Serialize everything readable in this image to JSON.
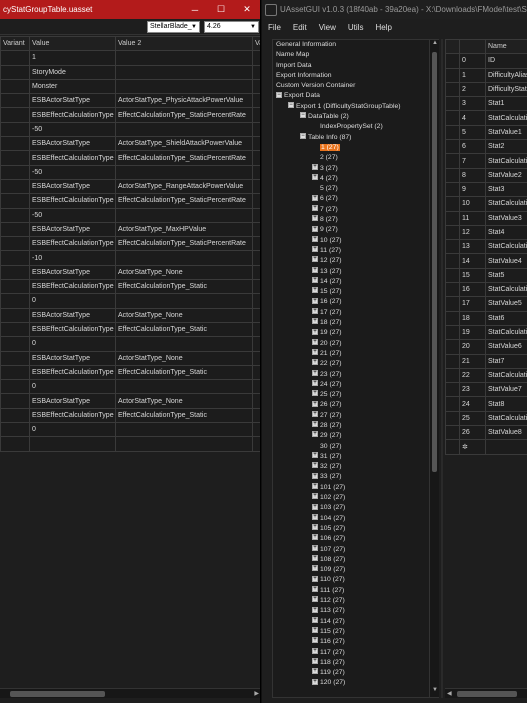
{
  "left_window": {
    "title": "cyStatGroupTable.uasset",
    "minimize": "─",
    "maximize": "☐",
    "close": "✕",
    "combo_game": "StellarBlade_",
    "combo_version": "4.26",
    "columns": [
      "Variant",
      "Value",
      "Value 2",
      "Va"
    ],
    "rows": [
      [
        "",
        "1",
        "",
        ""
      ],
      [
        "",
        "StoryMode",
        "",
        ""
      ],
      [
        "",
        "Monster",
        "",
        ""
      ],
      [
        "",
        "ESBActorStatType",
        "ActorStatType_PhysicAttackPowerValue",
        ""
      ],
      [
        "",
        "ESBEffectCalculationType",
        "EffectCalculationType_StaticPercentRate",
        ""
      ],
      [
        "",
        "-50",
        "",
        ""
      ],
      [
        "",
        "ESBActorStatType",
        "ActorStatType_ShieldAttackPowerValue",
        ""
      ],
      [
        "",
        "ESBEffectCalculationType",
        "EffectCalculationType_StaticPercentRate",
        ""
      ],
      [
        "",
        "-50",
        "",
        ""
      ],
      [
        "",
        "ESBActorStatType",
        "ActorStatType_RangeAttackPowerValue",
        ""
      ],
      [
        "",
        "ESBEffectCalculationType",
        "EffectCalculationType_StaticPercentRate",
        ""
      ],
      [
        "",
        "-50",
        "",
        ""
      ],
      [
        "",
        "ESBActorStatType",
        "ActorStatType_MaxHPValue",
        ""
      ],
      [
        "",
        "ESBEffectCalculationType",
        "EffectCalculationType_StaticPercentRate",
        ""
      ],
      [
        "",
        "-10",
        "",
        ""
      ],
      [
        "",
        "ESBActorStatType",
        "ActorStatType_None",
        ""
      ],
      [
        "",
        "ESBEffectCalculationType",
        "EffectCalculationType_Static",
        ""
      ],
      [
        "",
        "0",
        "",
        ""
      ],
      [
        "",
        "ESBActorStatType",
        "ActorStatType_None",
        ""
      ],
      [
        "",
        "ESBEffectCalculationType",
        "EffectCalculationType_Static",
        ""
      ],
      [
        "",
        "0",
        "",
        ""
      ],
      [
        "",
        "ESBActorStatType",
        "ActorStatType_None",
        ""
      ],
      [
        "",
        "ESBEffectCalculationType",
        "EffectCalculationType_Static",
        ""
      ],
      [
        "",
        "0",
        "",
        ""
      ],
      [
        "",
        "ESBActorStatType",
        "ActorStatType_None",
        ""
      ],
      [
        "",
        "ESBEffectCalculationType",
        "EffectCalculationType_Static",
        ""
      ],
      [
        "",
        "0",
        "",
        ""
      ],
      [
        "",
        "",
        "",
        ""
      ]
    ]
  },
  "right_window": {
    "title": "UAssetGUI v1.0.3 (18f40ab - 39a20ea) - X:\\Downloads\\FModel\\test\\SB\\C",
    "menu": [
      "File",
      "Edit",
      "View",
      "Utils",
      "Help"
    ],
    "tree": [
      {
        "label": "General Information",
        "level": 0,
        "expander": ""
      },
      {
        "label": "Name Map",
        "level": 0,
        "expander": ""
      },
      {
        "label": "Import Data",
        "level": 0,
        "expander": ""
      },
      {
        "label": "Export Information",
        "level": 0,
        "expander": ""
      },
      {
        "label": "Custom Version Container",
        "level": 0,
        "expander": ""
      },
      {
        "label": "Export Data",
        "level": 0,
        "expander": "−"
      },
      {
        "label": "Export 1 (DifficultyStatGroupTable)",
        "level": 1,
        "expander": "−"
      },
      {
        "label": "DataTable (2)",
        "level": 2,
        "expander": "−"
      },
      {
        "label": "IndexPropertySet (2)",
        "level": 3,
        "expander": ""
      },
      {
        "label": "Table Info (87)",
        "level": 2,
        "expander": "−"
      },
      {
        "label": "1 (27)",
        "level": 3,
        "expander": "",
        "selected": true
      },
      {
        "label": "2 (27)",
        "level": 3,
        "expander": ""
      },
      {
        "label": "3 (27)",
        "level": 3,
        "expander": "+"
      },
      {
        "label": "4 (27)",
        "level": 3,
        "expander": "+"
      },
      {
        "label": "5 (27)",
        "level": 3,
        "expander": ""
      },
      {
        "label": "6 (27)",
        "level": 3,
        "expander": "+"
      },
      {
        "label": "7 (27)",
        "level": 3,
        "expander": "+"
      },
      {
        "label": "8 (27)",
        "level": 3,
        "expander": "+"
      },
      {
        "label": "9 (27)",
        "level": 3,
        "expander": "+"
      },
      {
        "label": "10 (27)",
        "level": 3,
        "expander": "+"
      },
      {
        "label": "11 (27)",
        "level": 3,
        "expander": "+"
      },
      {
        "label": "12 (27)",
        "level": 3,
        "expander": "+"
      },
      {
        "label": "13 (27)",
        "level": 3,
        "expander": "+"
      },
      {
        "label": "14 (27)",
        "level": 3,
        "expander": "+"
      },
      {
        "label": "15 (27)",
        "level": 3,
        "expander": "+"
      },
      {
        "label": "16 (27)",
        "level": 3,
        "expander": "+"
      },
      {
        "label": "17 (27)",
        "level": 3,
        "expander": "+"
      },
      {
        "label": "18 (27)",
        "level": 3,
        "expander": "+"
      },
      {
        "label": "19 (27)",
        "level": 3,
        "expander": "+"
      },
      {
        "label": "20 (27)",
        "level": 3,
        "expander": "+"
      },
      {
        "label": "21 (27)",
        "level": 3,
        "expander": "+"
      },
      {
        "label": "22 (27)",
        "level": 3,
        "expander": "+"
      },
      {
        "label": "23 (27)",
        "level": 3,
        "expander": "+"
      },
      {
        "label": "24 (27)",
        "level": 3,
        "expander": "+"
      },
      {
        "label": "25 (27)",
        "level": 3,
        "expander": "+"
      },
      {
        "label": "26 (27)",
        "level": 3,
        "expander": "+"
      },
      {
        "label": "27 (27)",
        "level": 3,
        "expander": "+"
      },
      {
        "label": "28 (27)",
        "level": 3,
        "expander": "+"
      },
      {
        "label": "29 (27)",
        "level": 3,
        "expander": "+"
      },
      {
        "label": "30 (27)",
        "level": 3,
        "expander": ""
      },
      {
        "label": "31 (27)",
        "level": 3,
        "expander": "+"
      },
      {
        "label": "32 (27)",
        "level": 3,
        "expander": "+"
      },
      {
        "label": "33 (27)",
        "level": 3,
        "expander": "+"
      },
      {
        "label": "101 (27)",
        "level": 3,
        "expander": "+"
      },
      {
        "label": "102 (27)",
        "level": 3,
        "expander": "+"
      },
      {
        "label": "103 (27)",
        "level": 3,
        "expander": "+"
      },
      {
        "label": "104 (27)",
        "level": 3,
        "expander": "+"
      },
      {
        "label": "105 (27)",
        "level": 3,
        "expander": "+"
      },
      {
        "label": "106 (27)",
        "level": 3,
        "expander": "+"
      },
      {
        "label": "107 (27)",
        "level": 3,
        "expander": "+"
      },
      {
        "label": "108 (27)",
        "level": 3,
        "expander": "+"
      },
      {
        "label": "109 (27)",
        "level": 3,
        "expander": "+"
      },
      {
        "label": "110 (27)",
        "level": 3,
        "expander": "+"
      },
      {
        "label": "111 (27)",
        "level": 3,
        "expander": "+"
      },
      {
        "label": "112 (27)",
        "level": 3,
        "expander": "+"
      },
      {
        "label": "113 (27)",
        "level": 3,
        "expander": "+"
      },
      {
        "label": "114 (27)",
        "level": 3,
        "expander": "+"
      },
      {
        "label": "115 (27)",
        "level": 3,
        "expander": "+"
      },
      {
        "label": "116 (27)",
        "level": 3,
        "expander": "+"
      },
      {
        "label": "117 (27)",
        "level": 3,
        "expander": "+"
      },
      {
        "label": "118 (27)",
        "level": 3,
        "expander": "+"
      },
      {
        "label": "119 (27)",
        "level": 3,
        "expander": "+"
      },
      {
        "label": "120 (27)",
        "level": 3,
        "expander": "+"
      }
    ],
    "grid_columns": [
      "",
      "Name"
    ],
    "grid_rows": [
      [
        "0",
        "ID"
      ],
      [
        "1",
        "DifficultyAlias"
      ],
      [
        "2",
        "DifficultyStat"
      ],
      [
        "3",
        "Stat1"
      ],
      [
        "4",
        "StatCalculatio"
      ],
      [
        "5",
        "StatValue1"
      ],
      [
        "6",
        "Stat2"
      ],
      [
        "7",
        "StatCalculatio"
      ],
      [
        "8",
        "StatValue2"
      ],
      [
        "9",
        "Stat3"
      ],
      [
        "10",
        "StatCalculatio"
      ],
      [
        "11",
        "StatValue3"
      ],
      [
        "12",
        "Stat4"
      ],
      [
        "13",
        "StatCalculatio"
      ],
      [
        "14",
        "StatValue4"
      ],
      [
        "15",
        "Stat5"
      ],
      [
        "16",
        "StatCalculatio"
      ],
      [
        "17",
        "StatValue5"
      ],
      [
        "18",
        "Stat6"
      ],
      [
        "19",
        "StatCalculatio"
      ],
      [
        "20",
        "StatValue6"
      ],
      [
        "21",
        "Stat7"
      ],
      [
        "22",
        "StatCalculatio"
      ],
      [
        "23",
        "StatValue7"
      ],
      [
        "24",
        "Stat8"
      ],
      [
        "25",
        "StatCalculatio"
      ],
      [
        "26",
        "StatValue8"
      ],
      [
        "✲",
        ""
      ]
    ]
  }
}
